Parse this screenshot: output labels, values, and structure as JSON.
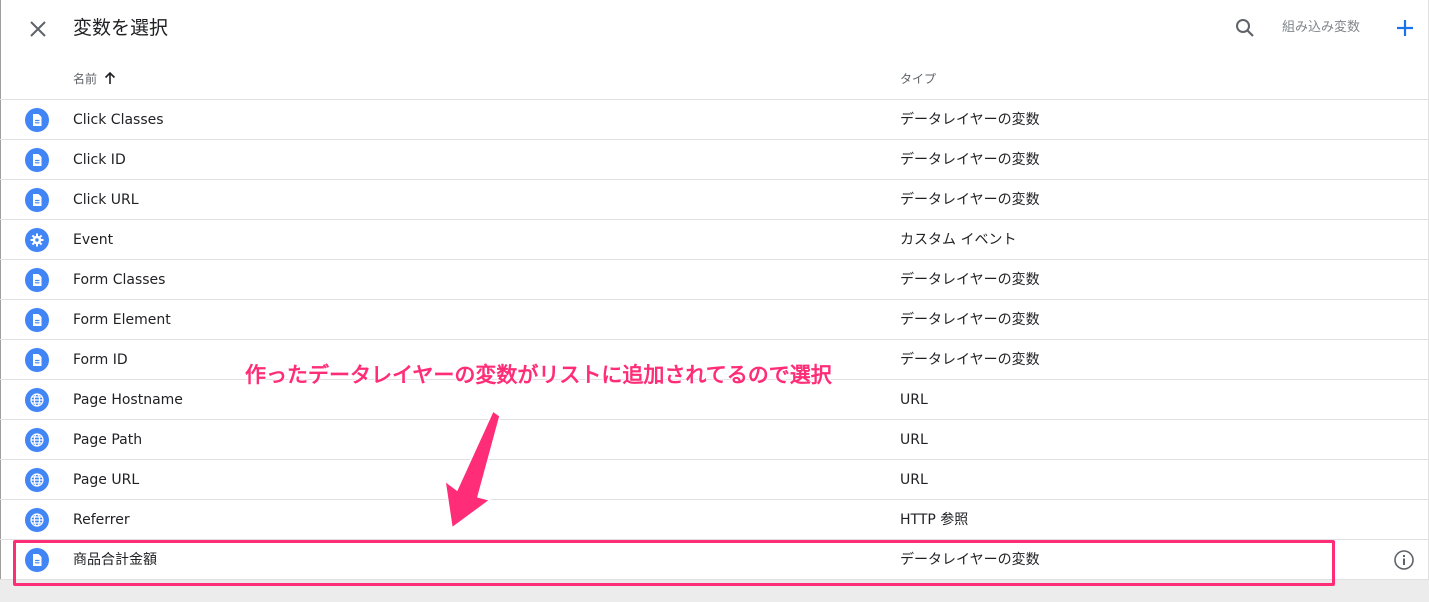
{
  "header": {
    "close_icon": "close-icon",
    "title": "変数を選択",
    "search_icon": "search-icon",
    "builtin_label": "組み込み変数",
    "add_icon": "add-icon",
    "accent_color": "#1a73e8"
  },
  "columns": {
    "name": "名前",
    "sort_icon": "arrow-upward-icon",
    "type": "タイプ"
  },
  "rows": [
    {
      "icon": "document-icon",
      "name": "Click Classes",
      "type": "データレイヤーの変数"
    },
    {
      "icon": "document-icon",
      "name": "Click ID",
      "type": "データレイヤーの変数"
    },
    {
      "icon": "document-icon",
      "name": "Click URL",
      "type": "データレイヤーの変数"
    },
    {
      "icon": "gear-icon",
      "name": "Event",
      "type": "カスタム イベント"
    },
    {
      "icon": "document-icon",
      "name": "Form Classes",
      "type": "データレイヤーの変数"
    },
    {
      "icon": "document-icon",
      "name": "Form Element",
      "type": "データレイヤーの変数"
    },
    {
      "icon": "document-icon",
      "name": "Form ID",
      "type": "データレイヤーの変数"
    },
    {
      "icon": "globe-icon",
      "name": "Page Hostname",
      "type": "URL"
    },
    {
      "icon": "globe-icon",
      "name": "Page Path",
      "type": "URL"
    },
    {
      "icon": "globe-icon",
      "name": "Page URL",
      "type": "URL"
    },
    {
      "icon": "globe-icon",
      "name": "Referrer",
      "type": "HTTP 参照"
    },
    {
      "icon": "document-icon",
      "name": "商品合計金額",
      "type": "データレイヤーの変数"
    }
  ],
  "info_icon": "info-icon",
  "icon_color": "#4285f4",
  "annotation": {
    "text": "作ったデータレイヤーの変数がリストに追加されてるので選択",
    "color": "#ff2d78"
  }
}
